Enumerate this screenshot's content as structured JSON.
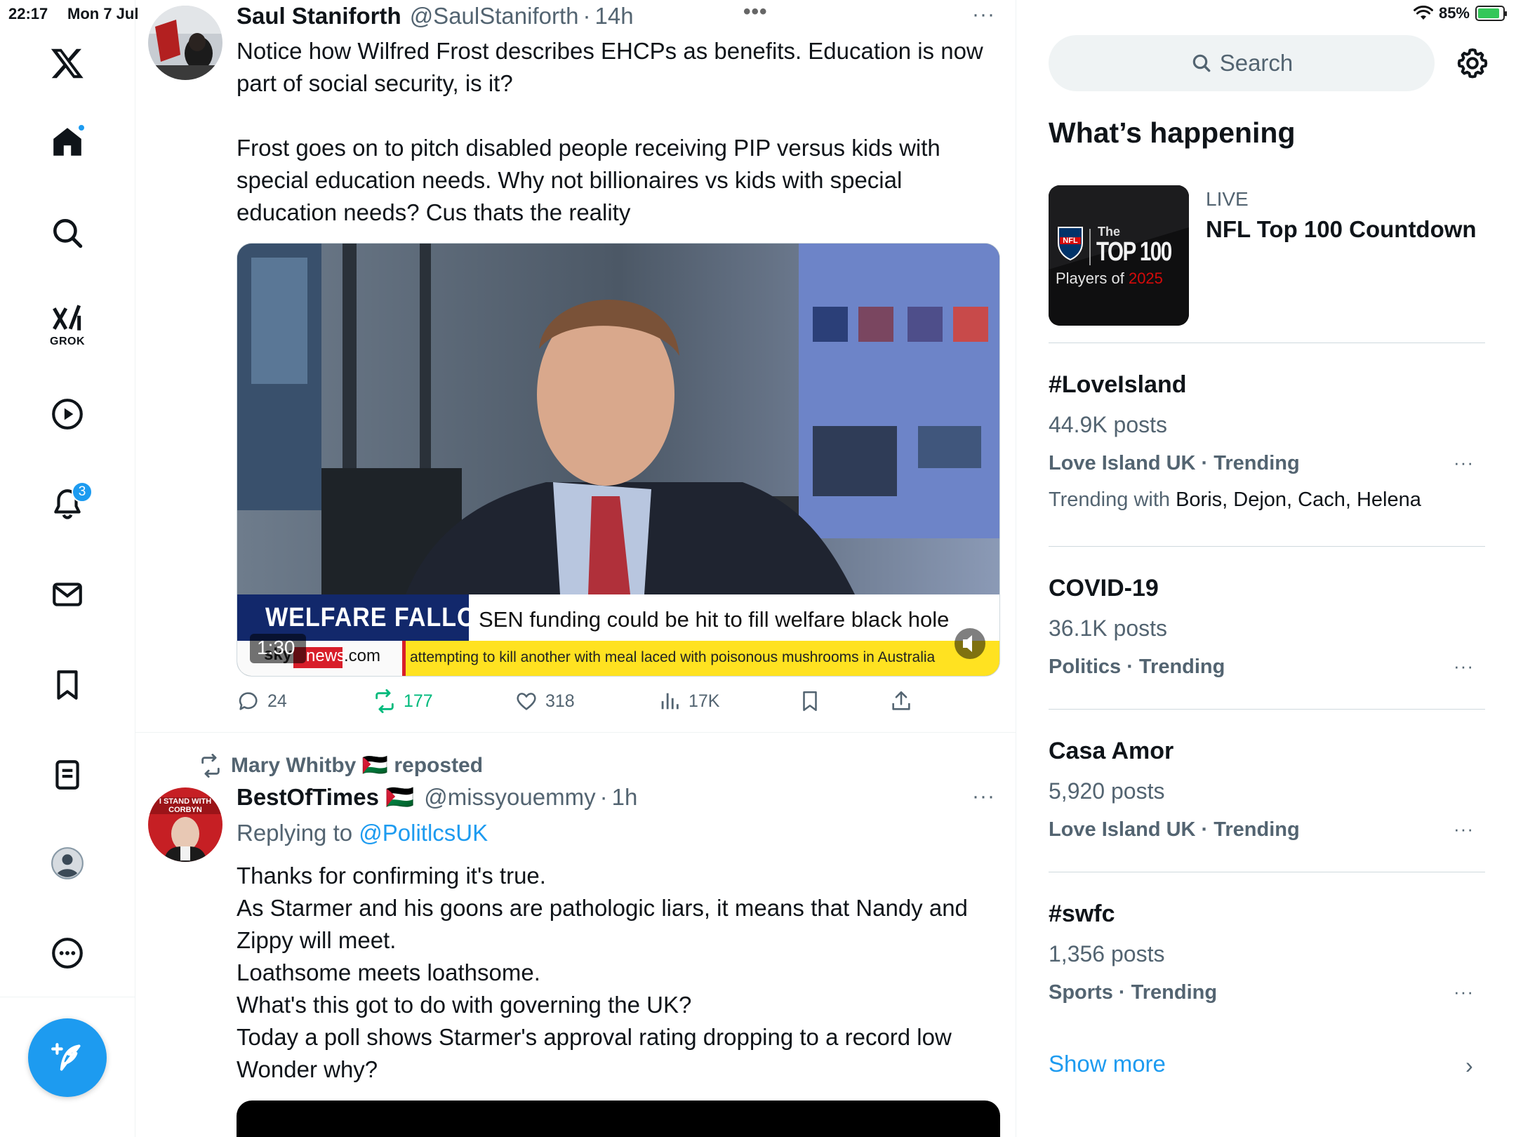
{
  "status_bar": {
    "time": "22:17",
    "date": "Mon 7 Jul",
    "battery": "85%"
  },
  "nav": {
    "grok_label": "GROK",
    "notifications_count": "3"
  },
  "tweet1": {
    "name": "Saul Staniforth",
    "handle": "@SaulStaniforth",
    "time": "14h",
    "dots": "•••",
    "more": "···",
    "text_p1": "Notice how Wilfred Frost describes EHCPs as benefits. Education is now part of social security, is it?",
    "text_p2": "Frost goes on to pitch disabled people receiving PIP versus kids with special education needs. Why not billionaires vs kids with special education needs? Cus thats the reality",
    "video": {
      "banner_left": "WELFARE FALLOUT",
      "banner_right": "SEN funding could be hit to fill welfare black hole",
      "sky_brand": "sky",
      "sky_news": "news",
      "sky_dotcom": ".com",
      "ticker": "attempting to kill another with meal laced with poisonous mushrooms in Australia",
      "duration": "1:30"
    },
    "stats": {
      "replies": "24",
      "reposts": "177",
      "likes": "318",
      "views": "17K"
    }
  },
  "tweet2": {
    "reposted_by": "Mary Whitby 🇵🇸 reposted",
    "name": "BestOfTimes 🇵🇸",
    "handle": "@missyouemmy",
    "time": "1h",
    "more": "···",
    "replying_label": "Replying to",
    "replying_handle": "@PolitlcsUK",
    "avatar_text": "I STAND WITH CORBYN",
    "lines": [
      "Thanks for confirming it's true.",
      "As Starmer and his goons are pathologic liars, it means that Nandy and Zippy will meet.",
      "Loathsome meets loathsome.",
      "What's this got to do with governing the UK?",
      "Today a poll shows Starmer's approval rating dropping to a record low",
      "Wonder why?"
    ]
  },
  "sidebar": {
    "search_placeholder": "Search",
    "heading": "What’s happening",
    "live": {
      "label": "LIVE",
      "title": "NFL Top 100 Countdown",
      "img_the": "The",
      "img_top100": "TOP 100",
      "img_players": "Players of",
      "img_year": "2025",
      "img_nfl": "NFL"
    },
    "trends": [
      {
        "name": "#LoveIsland",
        "count": "44.9K posts",
        "category": "Love Island UK · Trending",
        "with_label": "Trending with",
        "with_names": "Boris, Dejon, Cach, Helena"
      },
      {
        "name": "COVID-19",
        "count": "36.1K posts",
        "category": "Politics · Trending"
      },
      {
        "name": "Casa Amor",
        "count": "5,920 posts",
        "category": "Love Island UK · Trending"
      },
      {
        "name": "#swfc",
        "count": "1,356 posts",
        "category": "Sports · Trending"
      }
    ],
    "trend_more": "···",
    "show_more": "Show more",
    "show_more_chevron": "›"
  },
  "colors": {
    "accent": "#1d9bf0",
    "repost_green": "#00ba7c",
    "text_primary": "#0f1419",
    "text_secondary": "#536471"
  }
}
